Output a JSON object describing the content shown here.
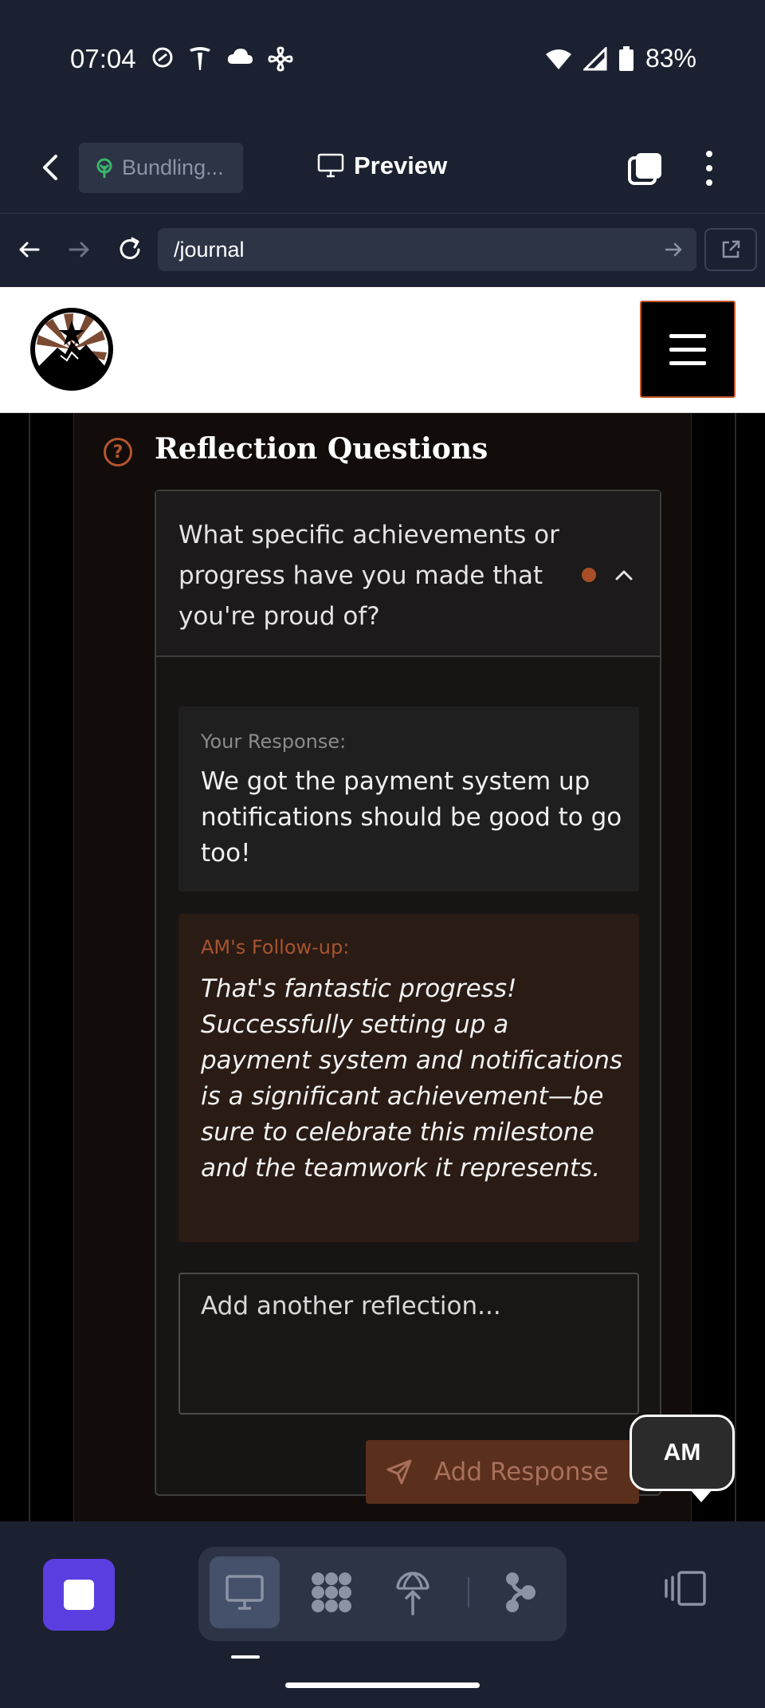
{
  "status_bar": {
    "time": "07:04",
    "battery": "83%",
    "icons": [
      "data-saver-icon",
      "tesla-icon",
      "cloud-icon",
      "pinwheel-icon",
      "wifi-icon",
      "signal-icon",
      "battery-icon"
    ]
  },
  "app_toolbar": {
    "branch_label": "Bundling...",
    "preview_label": "Preview"
  },
  "url_bar": {
    "url": "/journal"
  },
  "reflection": {
    "section_title": "Reflection Questions",
    "question": "What specific achievements or progress have you made that you're proud of?",
    "response_label": "Your Response:",
    "response_text": "We got the payment system up notifications should be good to go too!",
    "followup_label": "AM's Follow-up:",
    "followup_text": "That's fantastic progress! Successfully setting up a payment system and notifications is a significant achievement—be sure to celebrate this milestone and the teamwork it represents.",
    "input_placeholder": "Add another reflection...",
    "add_button_label": "Add Response"
  },
  "assistant_bubble": {
    "label": "AM"
  },
  "colors": {
    "accent": "#b4562f",
    "system_bg": "#1b2130",
    "stop_button": "#5b3ee0"
  }
}
